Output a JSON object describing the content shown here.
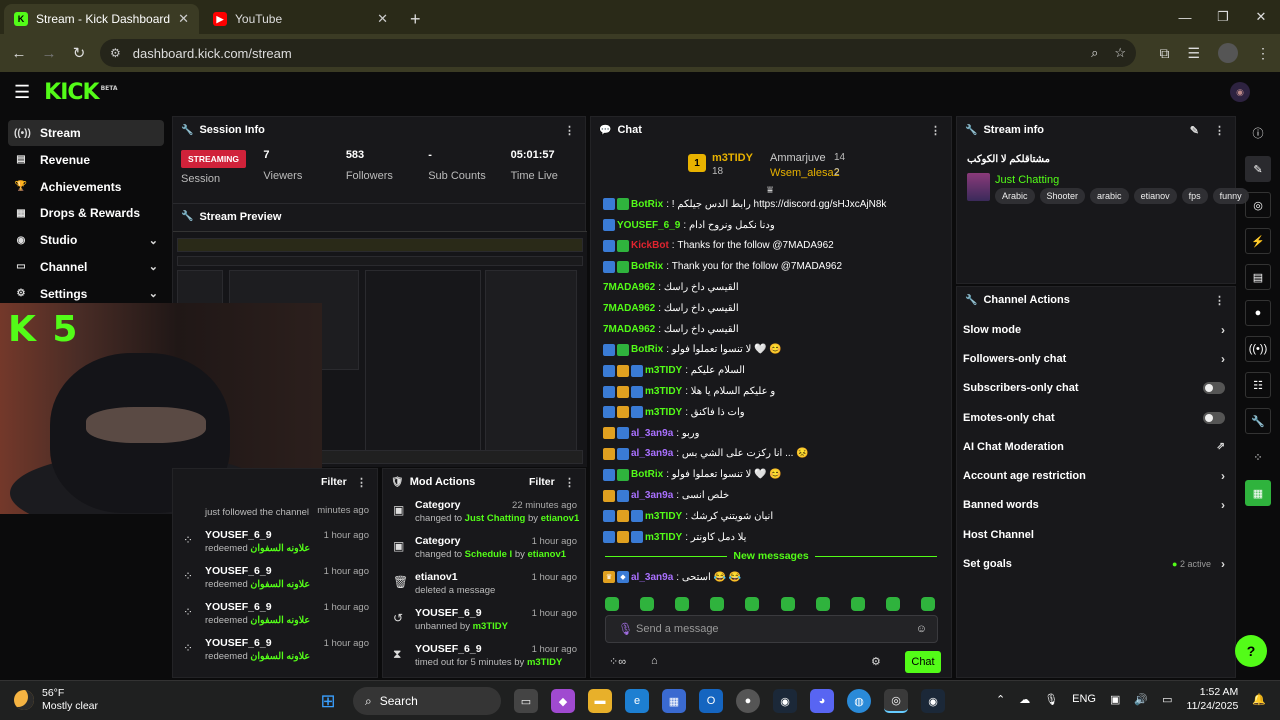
{
  "browser": {
    "tabs": [
      {
        "label": "Stream - Kick Dashboard",
        "active": true
      },
      {
        "label": "YouTube",
        "active": false
      }
    ],
    "url": "dashboard.kick.com/stream"
  },
  "sidebar": {
    "items": [
      {
        "label": "Stream",
        "icon": "broadcast-icon",
        "active": true
      },
      {
        "label": "Revenue",
        "icon": "revenue-icon"
      },
      {
        "label": "Achievements",
        "icon": "trophy-icon"
      },
      {
        "label": "Drops & Rewards",
        "icon": "drops-icon"
      },
      {
        "label": "Studio",
        "icon": "studio-icon",
        "chevron": true
      },
      {
        "label": "Channel",
        "icon": "channel-icon",
        "chevron": true
      },
      {
        "label": "Settings",
        "icon": "gear-icon",
        "chevron": true
      }
    ]
  },
  "session": {
    "title": "Session Info",
    "status": "STREAMING",
    "status_label": "Session",
    "viewers": "7",
    "viewers_label": "Viewers",
    "followers": "583",
    "followers_label": "Followers",
    "subs": "-",
    "subs_label": "Sub Counts",
    "time": "05:01:57",
    "time_label": "Time Live"
  },
  "preview": {
    "title": "Stream Preview"
  },
  "webcam": {
    "logo_text": "K 5"
  },
  "activity": {
    "filter_label": "Filter",
    "partial_time": "minutes ago",
    "partial_desc": "just followed the channel",
    "rows": [
      {
        "name": "YOUSEF_6_9",
        "time": "1 hour ago",
        "desc": "redeemed",
        "reward": "علاونه السفوان"
      },
      {
        "name": "YOUSEF_6_9",
        "time": "1 hour ago",
        "desc": "redeemed",
        "reward": "علاونه السفوان"
      },
      {
        "name": "YOUSEF_6_9",
        "time": "1 hour ago",
        "desc": "redeemed",
        "reward": "علاونه السفوان"
      },
      {
        "name": "YOUSEF_6_9",
        "time": "1 hour ago",
        "desc": "redeemed",
        "reward": "علاونه السفوان"
      }
    ]
  },
  "mod": {
    "title": "Mod Actions",
    "filter_label": "Filter",
    "rows": [
      {
        "name": "Category",
        "time": "22 minutes ago",
        "desc": "changed to",
        "hl": "Just Chatting",
        "by": "by",
        "user": "etianov1",
        "icon": "category-icon"
      },
      {
        "name": "Category",
        "time": "1 hour ago",
        "desc": "changed to",
        "hl": "Schedule I",
        "by": "by",
        "user": "etianov1",
        "icon": "category-icon"
      },
      {
        "name": "etianov1",
        "time": "1 hour ago",
        "desc": "deleted a message",
        "hl": "",
        "by": "",
        "user": "",
        "icon": "trash-icon"
      },
      {
        "name": "YOUSEF_6_9",
        "time": "1 hour ago",
        "desc": "unbanned by",
        "hl": "",
        "by": "",
        "user": "m3TIDY",
        "icon": "unban-icon"
      },
      {
        "name": "YOUSEF_6_9",
        "time": "1 hour ago",
        "desc": "timed out for 5 minutes by",
        "hl": "",
        "by": "",
        "user": "m3TIDY",
        "icon": "timeout-icon"
      }
    ]
  },
  "chat": {
    "title": "Chat",
    "top": {
      "rank": "1",
      "name": "m3TIDY",
      "count": "18",
      "u2": "Ammarjuve",
      "c2": "14",
      "u3": "Wsem_alesa2",
      "c3": "2"
    },
    "messages": [
      {
        "user": "BotRix",
        "color": "#53fc18",
        "text": "! رابط الدس جيلكم https://discord.gg/sHJxcAjN8k",
        "badges": [
          "#3a7bd5",
          "#2fb33d"
        ]
      },
      {
        "user": "YOUSEF_6_9",
        "color": "#53fc18",
        "text": "ودنا نكمل ونروح ادام",
        "badges": [
          "#3a7bd5"
        ]
      },
      {
        "user": "KickBot",
        "color": "#e0242f",
        "text": "Thanks for the follow @7MADA962",
        "badges": [
          "#3a7bd5",
          "#2fb33d"
        ]
      },
      {
        "user": "BotRix",
        "color": "#53fc18",
        "text": "Thank you for the follow @7MADA962",
        "badges": [
          "#3a7bd5",
          "#2fb33d"
        ]
      },
      {
        "user": "7MADA962",
        "color": "#53fc18",
        "text": "القيسي داخ راسك",
        "badges": []
      },
      {
        "user": "7MADA962",
        "color": "#53fc18",
        "text": "القيسي داخ راسك",
        "badges": []
      },
      {
        "user": "7MADA962",
        "color": "#53fc18",
        "text": "القيسي داخ راسك",
        "badges": []
      },
      {
        "user": "BotRix",
        "color": "#53fc18",
        "text": "لا تنسوا تعملوا فولو 🤍 😊",
        "badges": [
          "#3a7bd5",
          "#2fb33d"
        ]
      },
      {
        "user": "m3TIDY",
        "color": "#53fc18",
        "text": "السلام عليكم",
        "badges": [
          "#3a7bd5",
          "#e0a020",
          "#3a7bd5"
        ]
      },
      {
        "user": "m3TIDY",
        "color": "#53fc18",
        "text": "و عليكم السلام يا هلا",
        "badges": [
          "#3a7bd5",
          "#e0a020",
          "#3a7bd5"
        ]
      },
      {
        "user": "m3TIDY",
        "color": "#53fc18",
        "text": "وات ذا فاكنق",
        "badges": [
          "#3a7bd5",
          "#e0a020",
          "#3a7bd5"
        ]
      },
      {
        "user": "al_3an9a",
        "color": "#a970ff",
        "text": "وربو",
        "badges": [
          "#e0a020",
          "#3a7bd5"
        ]
      },
      {
        "user": "al_3an9a",
        "color": "#a970ff",
        "text": "انا ركزت على الشي بس ... 😣",
        "badges": [
          "#e0a020",
          "#3a7bd5"
        ]
      },
      {
        "user": "BotRix",
        "color": "#53fc18",
        "text": "لا تنسوا تعملوا فولو 🤍 😊",
        "badges": [
          "#3a7bd5",
          "#2fb33d"
        ]
      },
      {
        "user": "al_3an9a",
        "color": "#a970ff",
        "text": "خلص انسى",
        "badges": [
          "#e0a020",
          "#3a7bd5"
        ]
      },
      {
        "user": "m3TIDY",
        "color": "#53fc18",
        "text": "انيان شويتني كرشك",
        "badges": [
          "#3a7bd5",
          "#e0a020",
          "#3a7bd5"
        ]
      },
      {
        "user": "m3TIDY",
        "color": "#53fc18",
        "text": "يلا دمل كاونتر",
        "badges": [
          "#3a7bd5",
          "#e0a020",
          "#3a7bd5"
        ]
      }
    ],
    "new_messages": "New messages",
    "last": {
      "user": "al_3an9a",
      "text": "استحى 😂 😂"
    },
    "placeholder": "Send a message",
    "send_label": "Chat"
  },
  "stream_info": {
    "title": "Stream info",
    "stream_title": "مشتاقلكم لا الكوكب",
    "category": "Just Chatting",
    "tags": [
      "Arabic",
      "Shooter",
      "arabic",
      "etianov",
      "fps",
      "funny"
    ]
  },
  "channel_actions": {
    "title": "Channel Actions",
    "items": [
      {
        "label": "Slow mode",
        "control": "chevron"
      },
      {
        "label": "Followers-only chat",
        "control": "chevron"
      },
      {
        "label": "Subscribers-only chat",
        "control": "toggle"
      },
      {
        "label": "Emotes-only chat",
        "control": "toggle"
      },
      {
        "label": "AI Chat Moderation",
        "control": "external"
      },
      {
        "label": "Account age restriction",
        "control": "chevron"
      },
      {
        "label": "Banned words",
        "control": "chevron"
      },
      {
        "label": "Host Channel",
        "control": "none"
      },
      {
        "label": "Set goals",
        "control": "chevron",
        "extra": "2 active"
      }
    ]
  },
  "taskbar": {
    "temp": "56°F",
    "weather": "Mostly clear",
    "search": "Search",
    "lang": "ENG",
    "time": "1:52 AM",
    "date": "11/24/2025"
  },
  "colors": {
    "accent": "#53fc18",
    "live": "#d0223a",
    "panel": "#18181b"
  }
}
